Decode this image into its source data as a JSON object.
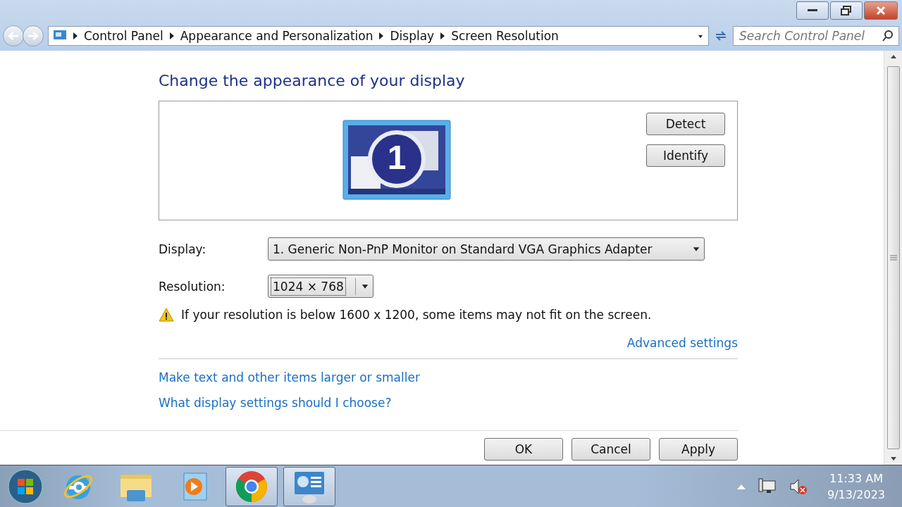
{
  "address_bar": {
    "breadcrumbs": [
      "Control Panel",
      "Appearance and Personalization",
      "Display",
      "Screen Resolution"
    ]
  },
  "search": {
    "placeholder": "Search Control Panel"
  },
  "heading": "Change the appearance of your display",
  "monitor": {
    "number": "1"
  },
  "side_buttons": [
    "Detect",
    "Identify"
  ],
  "fields": [
    {
      "label": "Display:",
      "value": "1. Generic Non-PnP Monitor on Standard VGA Graphics Adapter",
      "kind": "wide",
      "focused": false
    },
    {
      "label": "Resolution:",
      "value": "1024 × 768",
      "kind": "narrow",
      "focused": true
    }
  ],
  "warning": "If your resolution is below 1600 x 1200, some items may not fit on the screen.",
  "advanced_link": "Advanced settings",
  "help_links": [
    "Make text and other items larger or smaller",
    "What display settings should I choose?"
  ],
  "buttons": [
    "OK",
    "Cancel",
    "Apply"
  ],
  "taskbar": {
    "apps": [
      {
        "kind": "browser-e",
        "open": false
      },
      {
        "kind": "folder",
        "open": false
      },
      {
        "kind": "media",
        "open": false
      },
      {
        "kind": "chrome",
        "open": true
      },
      {
        "kind": "control-panel",
        "open": true
      }
    ]
  },
  "clock": {
    "time": "11:33 AM",
    "date": "9/13/2023"
  }
}
